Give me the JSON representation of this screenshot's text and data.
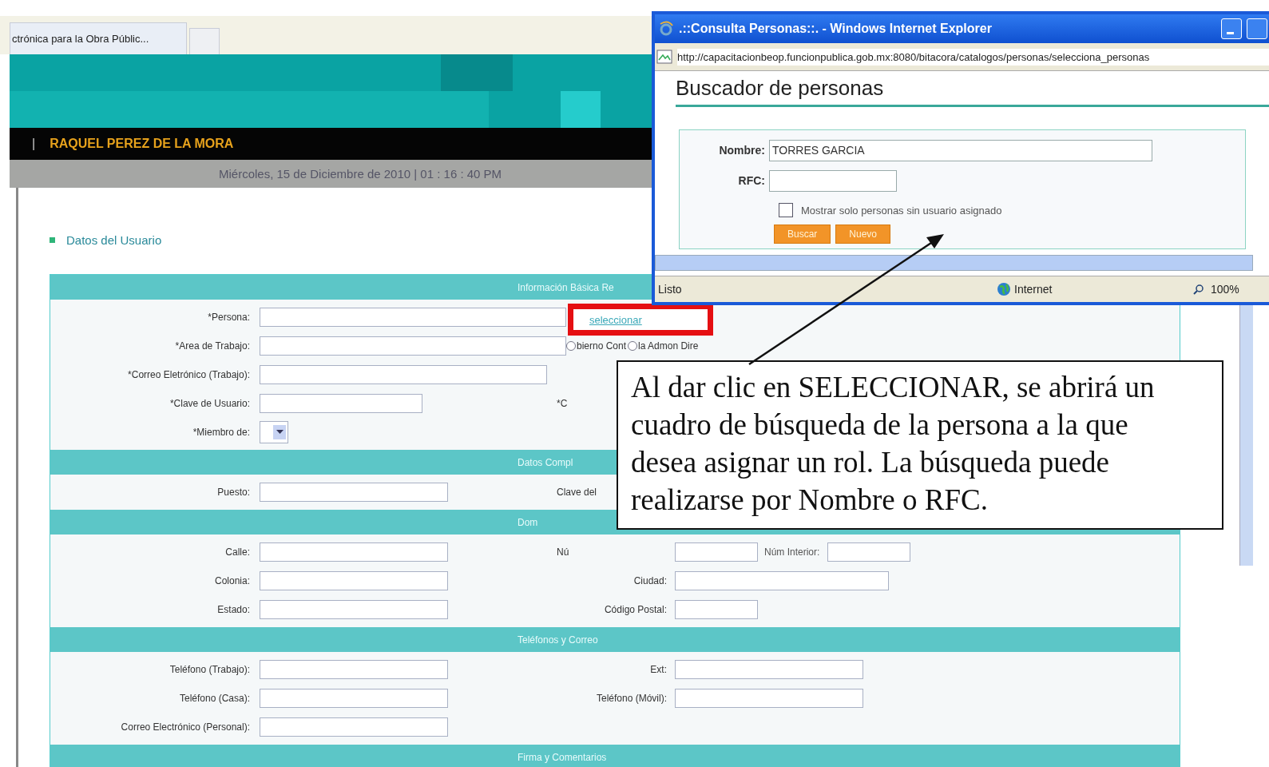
{
  "browser_tab": {
    "title": "ctrónica para la Obra Públic..."
  },
  "user_bar": {
    "separator": "|",
    "name": "RAQUEL  PEREZ  DE LA MORA"
  },
  "date_bar": {
    "text": "Miércoles, 15 de Diciembre de 2010 | 01 : 16 : 40 PM"
  },
  "section_title": "Datos del Usuario",
  "form": [
    {
      "title": "Información Básica Re",
      "rows": [
        {
          "label": "*Persona:",
          "field": {
            "kind": "long"
          },
          "extra": {
            "kind": "link",
            "text": "seleccionar"
          }
        },
        {
          "label": "*Area de Trabajo:",
          "field": {
            "kind": "long"
          },
          "extra": {
            "kind": "radios",
            "options": [
              {
                "label": "bierno Cont",
                "selected": false
              },
              {
                "label": "la Admon Dire",
                "selected": false
              }
            ]
          }
        },
        {
          "label": "*Correo Eletrónico (Trabajo):",
          "field": {
            "kind": "long"
          }
        },
        {
          "label": "*Clave de Usuario:",
          "field": {
            "kind": "medium"
          },
          "right": {
            "label": "*C",
            "kind": "cut"
          }
        },
        {
          "label": "*Miembro de:",
          "field": {
            "kind": "select"
          }
        }
      ]
    },
    {
      "title": "Datos Compl",
      "rows": [
        {
          "label": "Puesto:",
          "field": {
            "kind": "wide"
          },
          "right": {
            "label": "Clave del",
            "kind": "cut"
          }
        }
      ]
    },
    {
      "title": "Dom",
      "rows": [
        {
          "label": "Calle:",
          "field": {
            "kind": "wide"
          },
          "right": {
            "label": "Nú",
            "kind": "cut",
            "field": {
              "kind": "small"
            }
          },
          "extra": {
            "kind": "pair",
            "text": "Núm Interior:"
          }
        },
        {
          "label": "Colonia:",
          "field": {
            "kind": "wide"
          },
          "right": {
            "label": "Ciudad:",
            "kind": "full",
            "field": {
              "kind": "city"
            }
          }
        },
        {
          "label": "Estado:",
          "field": {
            "kind": "wide"
          },
          "right": {
            "label": "Código Postal:",
            "kind": "full",
            "field": {
              "kind": "small"
            }
          }
        }
      ]
    },
    {
      "title": "Teléfonos y Correo",
      "rows": [
        {
          "label": "Teléfono (Trabajo):",
          "field": {
            "kind": "wide"
          },
          "right": {
            "label": "Ext:",
            "kind": "full",
            "field": {
              "kind": "wide"
            }
          }
        },
        {
          "label": "Teléfono (Casa):",
          "field": {
            "kind": "wide"
          },
          "right": {
            "label": "Teléfono (Móvil):",
            "kind": "full",
            "field": {
              "kind": "wide"
            }
          }
        },
        {
          "label": "Correo Electrónico (Personal):",
          "field": {
            "kind": "wide"
          }
        }
      ]
    },
    {
      "title": "Firma y Comentarios"
    }
  ],
  "popup": {
    "title": ".::Consulta Personas::. - Windows Internet Explorer",
    "address": "http://capacitacionbeop.funcionpublica.gob.mx:8080/bitacora/catalogos/personas/selecciona_personas",
    "heading": "Buscador de personas",
    "fields": [
      {
        "label": "Nombre:",
        "value": "TORRES GARCIA",
        "kind": "long"
      },
      {
        "label": "RFC:",
        "kind": "short"
      }
    ],
    "checkbox": {
      "label": "Mostrar solo personas sin usuario asignado",
      "checked": false
    },
    "buttons": [
      "Buscar",
      "Nuevo"
    ],
    "status": {
      "text": "Listo",
      "zone": "Internet",
      "zoom": "100%"
    }
  },
  "callout": {
    "text": "Al dar clic en SELECCIONAR, se abrirá un cuadro de búsqueda de la persona a la que desea asignar un rol. La búsqueda puede realizarse por Nombre o RFC."
  }
}
